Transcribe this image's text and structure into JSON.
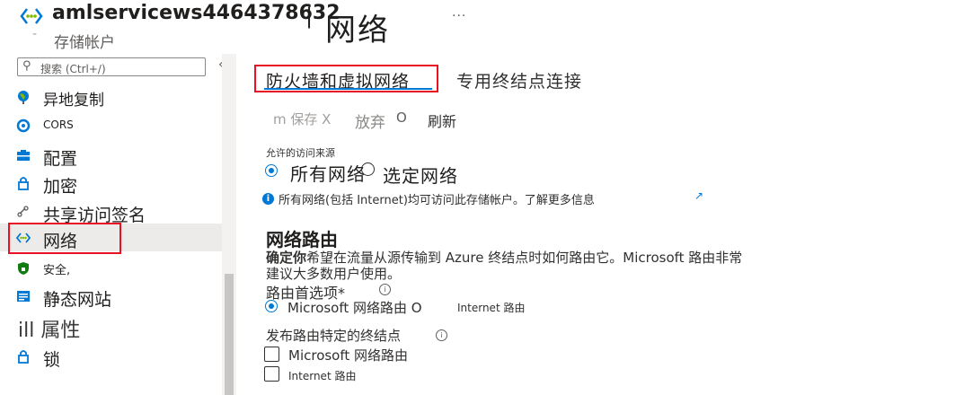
{
  "header": {
    "resource_name": "amlservicews4464378632",
    "divider": "|",
    "page_title": "网络",
    "more": "...",
    "resource_type": "存储帐户",
    "dash": "-"
  },
  "sidebar": {
    "search_placeholder": "搜索 (Ctrl+/)",
    "collapse": "«",
    "items": [
      {
        "label": "异地复制",
        "icon": "globe-icon"
      },
      {
        "label": "CORS",
        "icon": "cors-icon"
      },
      {
        "label": "配置",
        "icon": "configuration-icon"
      },
      {
        "label": "加密",
        "icon": "lock-icon"
      },
      {
        "label": "共享访问签名",
        "icon": "link-icon"
      },
      {
        "label": "网络",
        "icon": "network-icon"
      },
      {
        "label": "安全,",
        "icon": "shield-icon"
      },
      {
        "label": "静态网站",
        "icon": "static-website-icon"
      },
      {
        "label": "ill 属性",
        "icon": ""
      },
      {
        "label": "锁",
        "icon": "lock-icon"
      }
    ]
  },
  "tabs": {
    "firewall": "防火墙和虚拟网络",
    "private": "专用终结点连接"
  },
  "commands": {
    "save": "m 保存 X",
    "discard": "放弃",
    "discard_icon": "O",
    "refresh": "刷新"
  },
  "access": {
    "label": "允许的访问来源",
    "option_all": "所有网络",
    "option_selected": "选定网络",
    "info": "所有网络(包括 Internet)均可访问此存储帐户。了解更多信息",
    "info_icon_char": "i",
    "external_icon_char": "↗"
  },
  "routing": {
    "title": "网络路由",
    "desc_bold": "确定你",
    "desc_line1": "希望在流量从源传输到 Azure 终结点时如何路由它。Microsoft 路由非常",
    "desc_line2": "建议大多数用户使用。",
    "preference_label": "路由首选项*",
    "option_microsoft": "Microsoft 网络路由 O",
    "option_internet": "Internet 路由",
    "publish_label": "发布路由特定的终结点",
    "publish_microsoft": "Microsoft 网络路由",
    "publish_internet": "Internet 路由",
    "info_char": "i"
  },
  "colors": {
    "accent": "#0078d4",
    "highlight": "#e81123",
    "text": "#323130"
  }
}
